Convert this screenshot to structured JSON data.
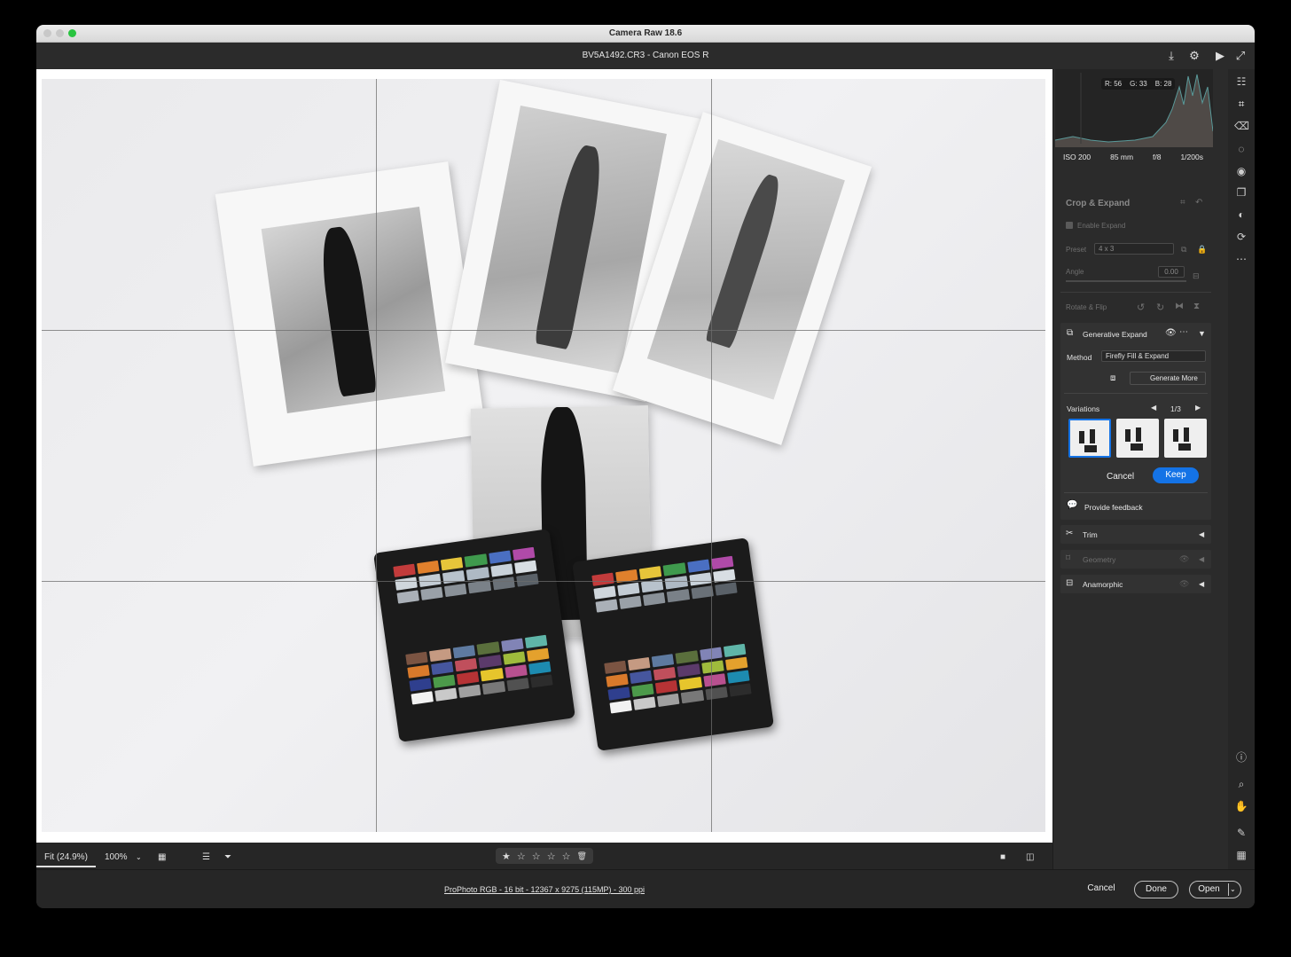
{
  "window": {
    "title": "Camera Raw 18.6",
    "file_info": "BV5A1492.CR3  -  Canon EOS R"
  },
  "histogram": {
    "r_label": "R:",
    "r": "56",
    "g_label": "G:",
    "g": "33",
    "b_label": "B:",
    "b": "28"
  },
  "camera": {
    "iso": "ISO 200",
    "focal": "85 mm",
    "aperture": "f/8",
    "shutter": "1/200s"
  },
  "crop": {
    "title": "Crop & Expand",
    "enable_expand": "Enable Expand",
    "preset_label": "Preset",
    "preset_value": "4 x 3",
    "angle_label": "Angle",
    "angle_value": "0.00",
    "rotate_label": "Rotate & Flip"
  },
  "genexpand": {
    "title": "Generative Expand",
    "method_label": "Method",
    "method_value": "Firefly Fill & Expand",
    "generate_more": "Generate More",
    "variations_label": "Variations",
    "variation_counter": "1/3",
    "cancel": "Cancel",
    "keep": "Keep",
    "feedback": "Provide feedback"
  },
  "sections": {
    "trim": "Trim",
    "geometry": "Geometry",
    "anamorphic": "Anamorphic"
  },
  "bottombar": {
    "zoom_fit": "Fit (24.9%)",
    "zoom_100": "100%",
    "stars": [
      "★",
      "☆",
      "☆",
      "☆",
      "☆"
    ]
  },
  "footer": {
    "workflow": "ProPhoto RGB - 16 bit - 12367 x 9275 (115MP) - 300 ppi",
    "cancel": "Cancel",
    "done": "Done",
    "open": "Open"
  },
  "colors": {
    "accent": "#1473e6",
    "panel": "#2b2b2b",
    "canvas": "#ffffff"
  },
  "icons": {
    "toolbar": [
      "save-icon",
      "settings-icon",
      "slideshow-icon",
      "fullscreen-icon"
    ],
    "tools": [
      "edit-icon",
      "crop-icon",
      "remove-icon",
      "masking-icon",
      "redeye-icon",
      "snapshots-icon",
      "presets-icon",
      "sync-icon",
      "more-icon",
      "info-icon",
      "zoom-icon",
      "hand-icon",
      "sampler-icon",
      "grid-icon"
    ]
  }
}
